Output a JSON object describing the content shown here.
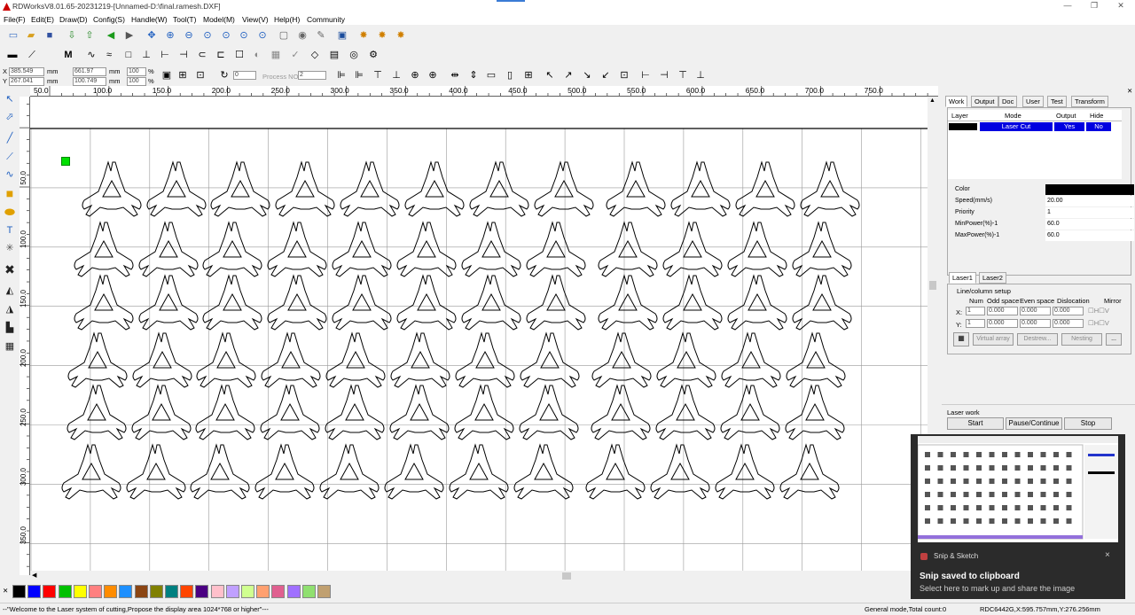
{
  "window": {
    "title": "RDWorksV8.01.65-20231219-[Unnamed-D:\\final.ramesh.DXF]"
  },
  "menu": [
    "File(F)",
    "Edit(E)",
    "Draw(D)",
    "Config(S)",
    "Handle(W)",
    "Tool(T)",
    "Model(M)",
    "View(V)",
    "Help(H)",
    "Community"
  ],
  "coords": {
    "x_label": "X",
    "x_val": "385.549",
    "y_label": "Y",
    "y_val": "267.041",
    "unit": "mm",
    "w_val": "661.97",
    "h_val": "100.749",
    "pct1": "100",
    "pct2": "100",
    "pct_sym": "%",
    "process_no_label": "Process NO:",
    "process_no": "2",
    "angle": "0"
  },
  "ruler": {
    "h_ticks": [
      "50.0",
      "100.0",
      "150.0",
      "200.0",
      "250.0",
      "300.0",
      "350.0",
      "400.0",
      "450.0",
      "500.0",
      "550.0",
      "600.0",
      "650.0",
      "700.0",
      "750.0"
    ],
    "v_ticks": [
      "50.0",
      "100.0",
      "150.0",
      "200.0",
      "250.0",
      "300.0",
      "350.0"
    ]
  },
  "panel": {
    "tabs": [
      "Work",
      "Output",
      "Doc",
      "User",
      "Test",
      "Transform"
    ],
    "layer_headers": [
      "Layer",
      "Mode",
      "Output",
      "Hide"
    ],
    "layer_row": {
      "color": "#000000",
      "mode": "Laser Cut",
      "output": "Yes",
      "hide": "No"
    },
    "props": [
      {
        "label": "Color",
        "value": ""
      },
      {
        "label": "Speed(mm/s)",
        "value": "20.00"
      },
      {
        "label": "Priority",
        "value": "1"
      },
      {
        "label": "MinPower(%)-1",
        "value": "60.0"
      },
      {
        "label": "MaxPower(%)-1",
        "value": "60.0"
      }
    ],
    "laser_tabs": [
      "Laser1",
      "Laser2"
    ],
    "array_group": "Line/column setup",
    "array_headers": [
      "Num",
      "Odd space",
      "Even space",
      "Dislocation",
      "Mirror"
    ],
    "array_x": {
      "label": "X:",
      "num": "1",
      "odd": "0.000",
      "even": "0.000",
      "disl": "0.000",
      "m1": "H",
      "m2": "V"
    },
    "array_y": {
      "label": "Y:",
      "num": "1",
      "odd": "0.000",
      "even": "0.000",
      "disl": "0.000",
      "m1": "H",
      "m2": "V"
    },
    "array_buttons": [
      "Virtual array",
      "Destrew...",
      "Nesting",
      "..."
    ],
    "laser_work": "Laser work",
    "work_buttons": [
      "Start",
      "Pause/Continue",
      "Stop"
    ]
  },
  "palette": [
    "#000000",
    "#0000ff",
    "#ff0000",
    "#00c000",
    "#ffff00",
    "#ff8080",
    "#ff8c00",
    "#1e90ff",
    "#8b4513",
    "#808000",
    "#008080",
    "#ff4500",
    "#4b0082",
    "#ffc0cb",
    "#c0a0ff",
    "#d0ff90",
    "#ffa070",
    "#e06090",
    "#a070ff",
    "#90e070",
    "#c0a070"
  ],
  "status": {
    "message": "--\"Welcome to the Laser system of cutting,Propose the display area 1024*768 or higher\"---",
    "mode": "General mode,Total count:0",
    "device": "RDC6442G,X:595.757mm,Y:276.256mm"
  },
  "toast": {
    "app": "Snip & Sketch",
    "title": "Snip saved to clipboard",
    "body": "Select here to mark up and share the image",
    "close": "×"
  }
}
